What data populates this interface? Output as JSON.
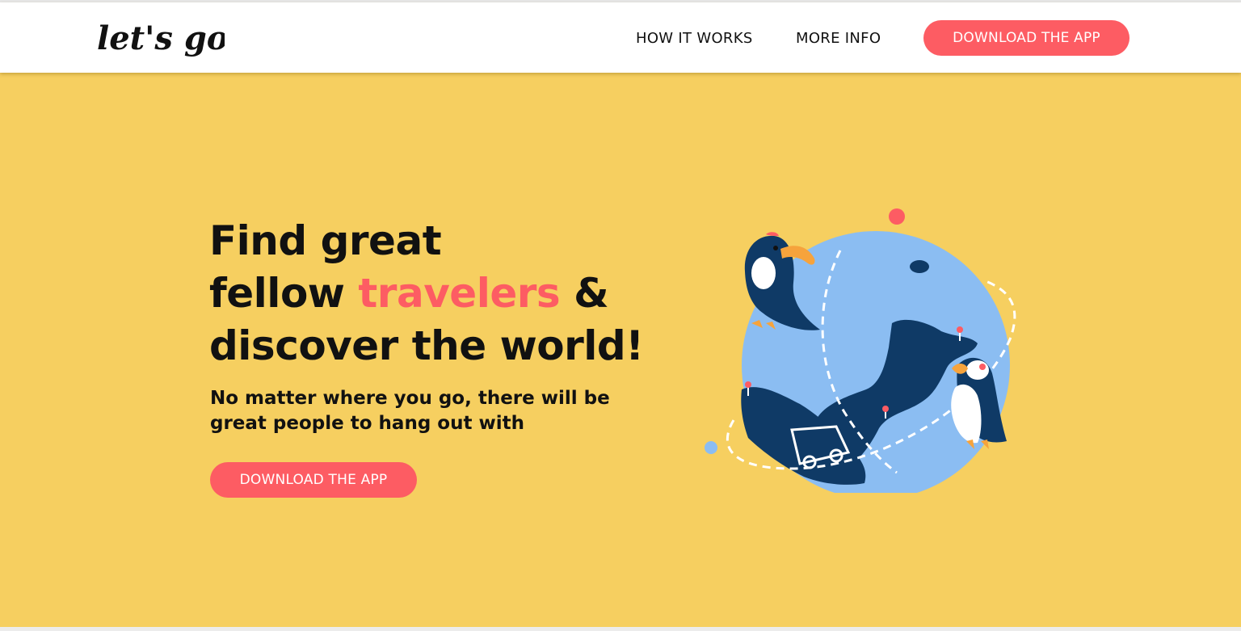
{
  "navbar": {
    "logo_text": "let's go!",
    "links": [
      {
        "label": "HOW IT WORKS"
      },
      {
        "label": "MORE INFO"
      }
    ],
    "cta_label": "DOWNLOAD THE APP"
  },
  "hero": {
    "headline_line1": "Find great",
    "headline_line2_start": "fellow ",
    "headline_accent": "travelers",
    "headline_line2_end": " &",
    "headline_line3": "discover the world!",
    "subheadline": "No matter where you go, there will be great people to hang out with",
    "cta_label": "DOWNLOAD THE APP"
  },
  "colors": {
    "accent": "#fd5c63",
    "hero_background": "#f6cf60",
    "globe": "#8bbdf2",
    "continents": "#0f3a66",
    "beak": "#f6a33c"
  },
  "icons": {
    "illustration": "globe-with-toucan-and-puffin-illustration",
    "car": "car-icon"
  }
}
